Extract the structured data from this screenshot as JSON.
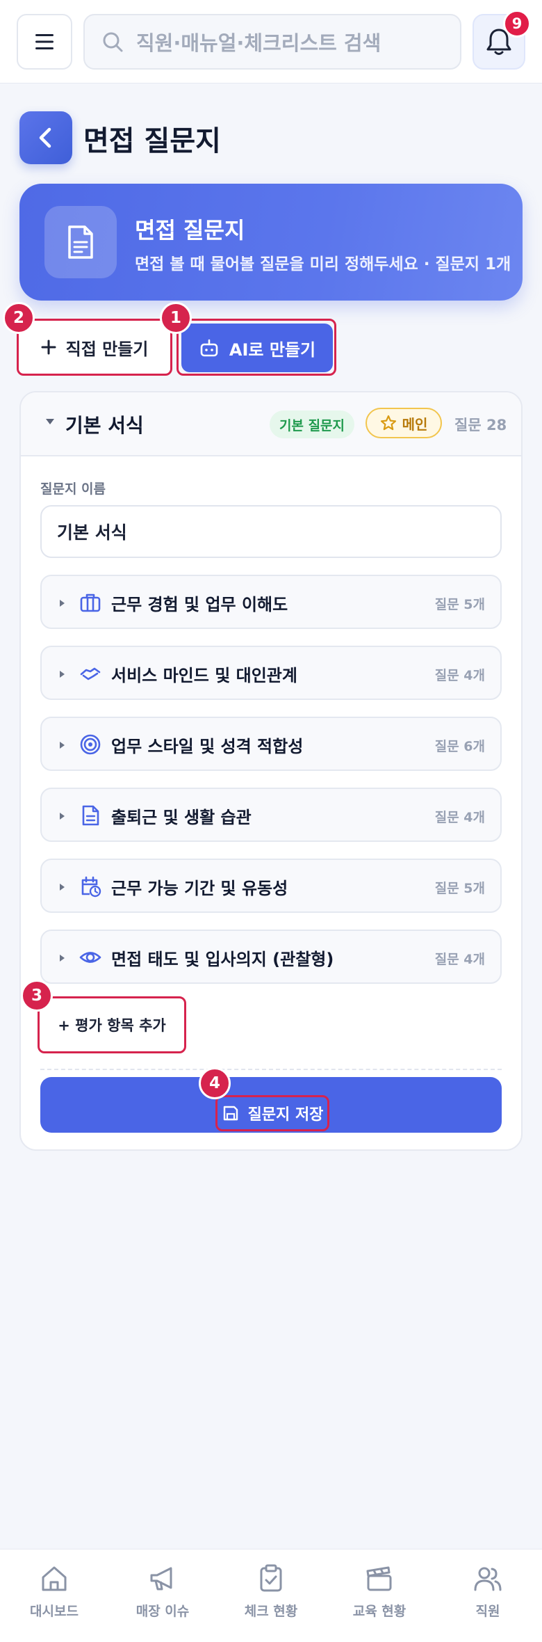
{
  "topbar": {
    "search_placeholder": "직원·매뉴얼·체크리스트 검색",
    "notification_count": "9"
  },
  "page": {
    "title": "면접 질문지"
  },
  "hero": {
    "title": "면접 질문지",
    "subtitle": "면접 볼 때 물어볼 질문을 미리 정해두세요 · 질문지 1개"
  },
  "actions": {
    "manual_label": "직접 만들기",
    "ai_label": "AI로 만들기"
  },
  "markers": {
    "m1": "1",
    "m2": "2",
    "m3": "3",
    "m4": "4"
  },
  "form": {
    "section_title": "기본 서식",
    "tag_basic": "기본 질문지",
    "tag_main": "메인",
    "total_count": "질문 28",
    "name_label": "질문지 이름",
    "name_value": "기본 서식",
    "items": [
      {
        "title": "근무 경험 및 업무 이해도",
        "count": "질문 5개",
        "icon": "briefcase-icon"
      },
      {
        "title": "서비스 마인드 및 대인관계",
        "count": "질문 4개",
        "icon": "handshake-icon"
      },
      {
        "title": "업무 스타일 및 성격 적합성",
        "count": "질문 6개",
        "icon": "target-icon"
      },
      {
        "title": "출퇴근 및 생활 습관",
        "count": "질문 4개",
        "icon": "document-icon"
      },
      {
        "title": "근무 가능 기간 및 유동성",
        "count": "질문 5개",
        "icon": "calendar-clock-icon"
      },
      {
        "title": "면접 태도 및 입사의지 (관찰형)",
        "count": "질문 4개",
        "icon": "eye-icon"
      }
    ],
    "add_label": "+ 평가 항목 추가",
    "save_label": "질문지 저장"
  },
  "bottom_nav": [
    {
      "label": "대시보드",
      "icon": "home-icon"
    },
    {
      "label": "매장 이슈",
      "icon": "megaphone-icon"
    },
    {
      "label": "체크 현황",
      "icon": "clipboard-check-icon"
    },
    {
      "label": "교육 현황",
      "icon": "clapperboard-icon"
    },
    {
      "label": "직원",
      "icon": "users-icon"
    }
  ],
  "colors": {
    "primary": "#4a65e6",
    "highlight": "#d6234d",
    "green_tag": "#1f9a4d",
    "gold_tag": "#b77a0a"
  }
}
